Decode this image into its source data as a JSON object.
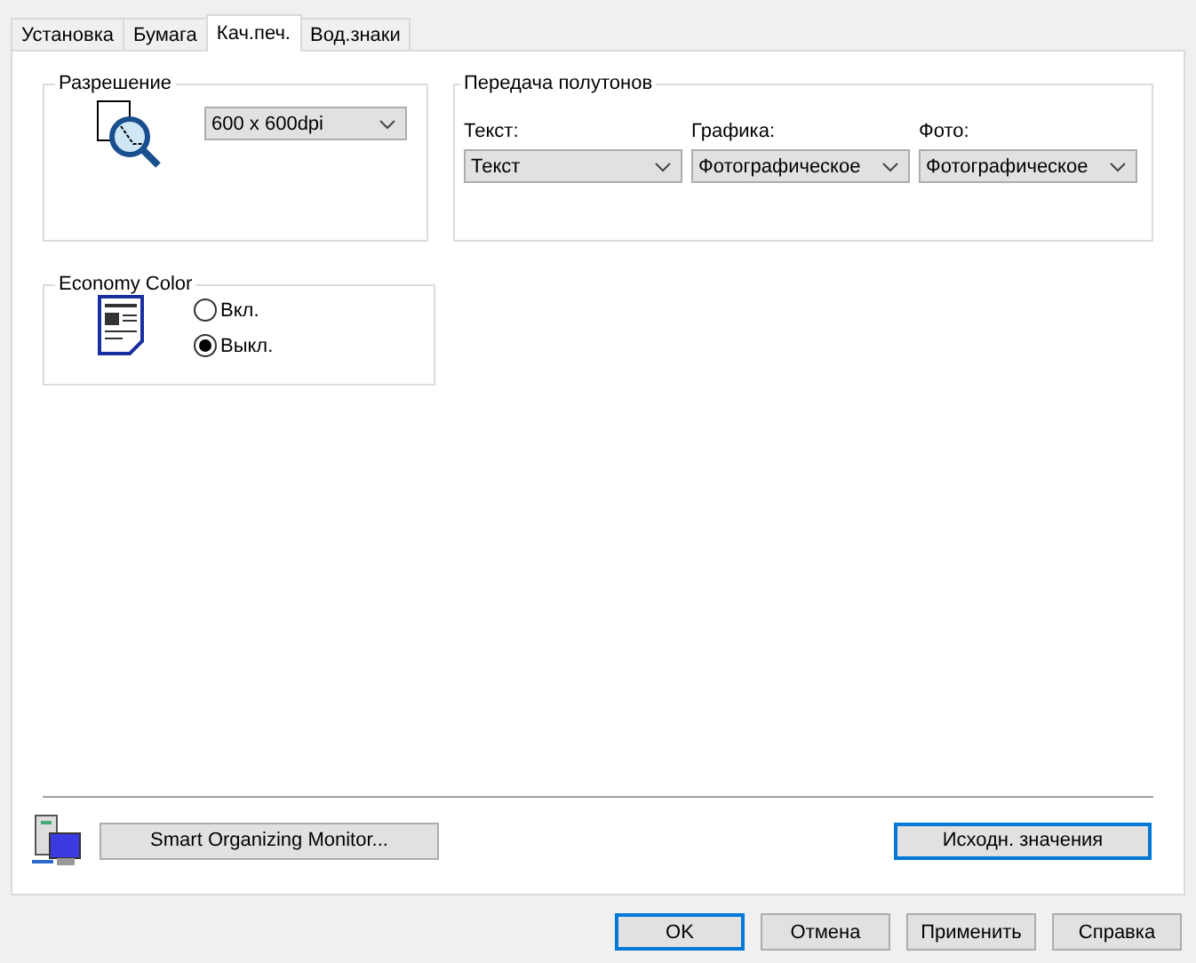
{
  "tabs": [
    {
      "label": "Установка",
      "selected": false
    },
    {
      "label": "Бумага",
      "selected": false
    },
    {
      "label": "Кач.печ.",
      "selected": true
    },
    {
      "label": "Вод.знаки",
      "selected": false
    }
  ],
  "resolution": {
    "title": "Разрешение",
    "value": "600 x 600dpi"
  },
  "halftone": {
    "title": "Передача полутонов",
    "fields": [
      {
        "label": "Текст:",
        "value": "Текст"
      },
      {
        "label": "Графика:",
        "value": "Фотографическое"
      },
      {
        "label": "Фото:",
        "value": "Фотографическое"
      }
    ]
  },
  "economy_color": {
    "title": "Economy Color",
    "options": [
      {
        "label": "Вкл.",
        "selected": false
      },
      {
        "label": "Выкл.",
        "selected": true
      }
    ]
  },
  "monitor_button": {
    "label": "Smart Organizing Monitor...",
    "default": false
  },
  "defaults_button": {
    "label": "Исходн. значения",
    "default": true
  },
  "buttons": [
    {
      "label": "OK",
      "default": true
    },
    {
      "label": "Отмена",
      "default": false
    },
    {
      "label": "Применить",
      "default": false
    },
    {
      "label": "Справка",
      "default": false
    }
  ]
}
